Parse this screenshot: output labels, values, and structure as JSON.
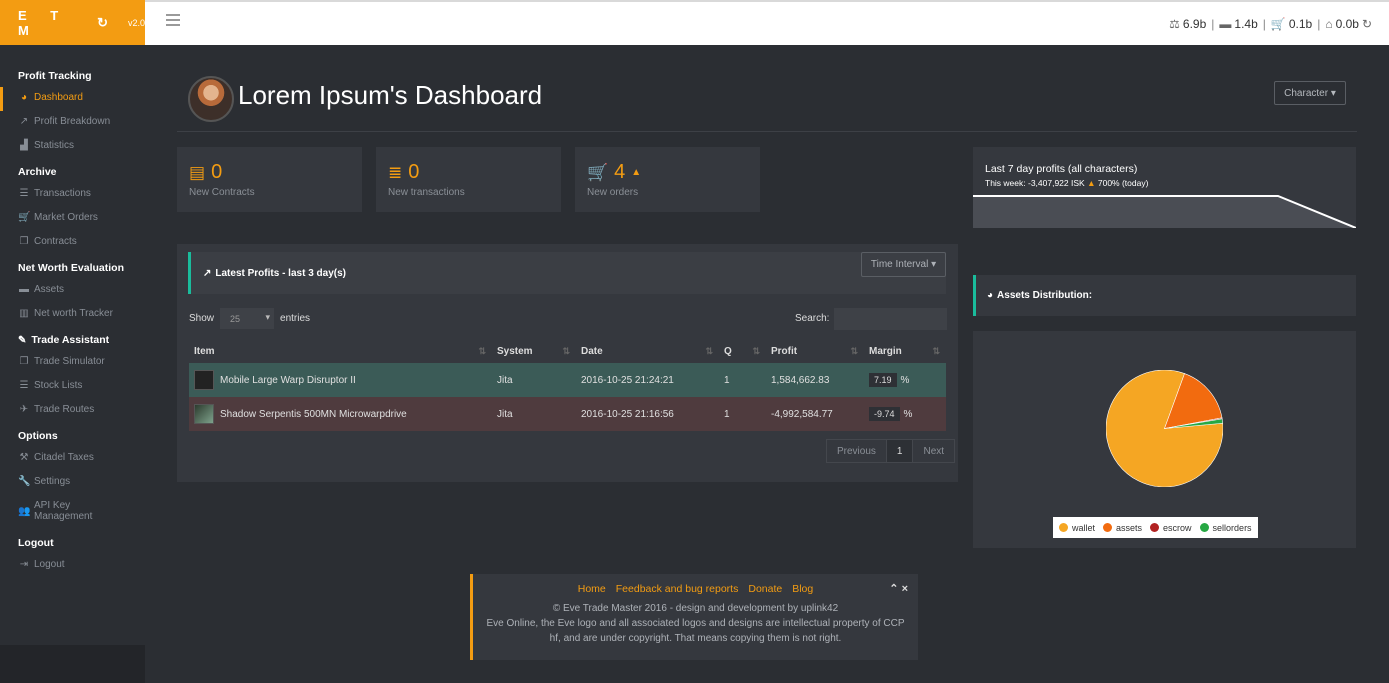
{
  "brand": {
    "logo": "E T M",
    "refresh_icon": "↻",
    "version": "v2.0"
  },
  "topbar": {
    "wealth": [
      {
        "icon": "scale-icon",
        "glyph": "⚖",
        "value": "6.9b"
      },
      {
        "icon": "briefcase-icon",
        "glyph": "▬",
        "value": "1.4b"
      },
      {
        "icon": "cart-icon",
        "glyph": "🛒",
        "value": "0.1b"
      },
      {
        "icon": "bank-icon",
        "glyph": "⌂",
        "value": "0.0b"
      }
    ],
    "separator": "|",
    "refresh_icon": "↻"
  },
  "sidebar": {
    "sections": [
      {
        "title": "Profit Tracking",
        "items": [
          {
            "label": "Dashboard",
            "icon": "dashboard-icon",
            "glyph": "◕",
            "active": true
          },
          {
            "label": "Profit Breakdown",
            "icon": "line-chart-icon",
            "glyph": "↗"
          },
          {
            "label": "Statistics",
            "icon": "area-chart-icon",
            "glyph": "▟"
          }
        ]
      },
      {
        "title": "Archive",
        "items": [
          {
            "label": "Transactions",
            "icon": "list-icon",
            "glyph": "☰"
          },
          {
            "label": "Market Orders",
            "icon": "cart-icon",
            "glyph": "🛒"
          },
          {
            "label": "Contracts",
            "icon": "copy-icon",
            "glyph": "❐"
          }
        ]
      },
      {
        "title": "Net Worth Evaluation",
        "items": [
          {
            "label": "Assets",
            "icon": "briefcase-icon",
            "glyph": "▬"
          },
          {
            "label": "Net worth Tracker",
            "icon": "bar-chart-icon",
            "glyph": "▥"
          }
        ]
      },
      {
        "title": "Trade Assistant",
        "title_icon": "magic-icon",
        "title_glyph": "✎",
        "items": [
          {
            "label": "Trade Simulator",
            "icon": "copy-icon",
            "glyph": "❐"
          },
          {
            "label": "Stock Lists",
            "icon": "list-icon",
            "glyph": "☰"
          },
          {
            "label": "Trade Routes",
            "icon": "plane-icon",
            "glyph": "✈"
          }
        ]
      },
      {
        "title": "Options",
        "items": [
          {
            "label": "Citadel Taxes",
            "icon": "gavel-icon",
            "glyph": "⚒"
          },
          {
            "label": "Settings",
            "icon": "wrench-icon",
            "glyph": "🔧"
          },
          {
            "label": "API Key Management",
            "icon": "users-icon",
            "glyph": "👥"
          }
        ]
      },
      {
        "title": "Logout",
        "items": [
          {
            "label": "Logout",
            "icon": "sign-out-icon",
            "glyph": "⇥"
          }
        ]
      }
    ]
  },
  "header": {
    "title": "Lorem Ipsum's Dashboard",
    "character_button": "Character ▾"
  },
  "stats": [
    {
      "value": "0",
      "label": "New Contracts",
      "icon": "contract-icon",
      "glyph": "▤"
    },
    {
      "value": "0",
      "label": "New transactions",
      "icon": "stack-icon",
      "glyph": "≣"
    },
    {
      "value": "4",
      "label": "New orders",
      "icon": "cart-icon",
      "glyph": "🛒",
      "trend": "▲"
    }
  ],
  "profits_panel": {
    "title": "Latest Profits - last 3 day(s)",
    "title_icon": "line-chart-icon",
    "time_button": "Time Interval ▾",
    "show_label": "Show",
    "entries_value": "25",
    "entries_label": "entries",
    "search_label": "Search:",
    "columns": [
      "Item",
      "System",
      "Date",
      "Q",
      "Profit",
      "Margin"
    ],
    "rows": [
      {
        "item": "Mobile Large Warp Disruptor II",
        "system": "Jita",
        "date": "2016-10-25 21:24:21",
        "q": "1",
        "profit": "1,584,662.83",
        "margin": "7.19",
        "unit": "%",
        "status": "positive"
      },
      {
        "item": "Shadow Serpentis 500MN Microwarpdrive",
        "system": "Jita",
        "date": "2016-10-25 21:16:56",
        "q": "1",
        "profit": "-4,992,584.77",
        "margin": "-9.74",
        "unit": "%",
        "status": "negative"
      }
    ],
    "pager": {
      "previous": "Previous",
      "current": "1",
      "next": "Next"
    }
  },
  "weekly_profit": {
    "title": "Last 7 day profits (all characters)",
    "sub_prefix": "This week: -3,407,922 ISK",
    "trend": "▲",
    "sub_suffix": "700% (today)"
  },
  "assets": {
    "title": "Assets Distribution:",
    "title_icon": "pie-chart-icon",
    "legend": [
      {
        "label": "wallet",
        "color": "#f5a623"
      },
      {
        "label": "assets",
        "color": "#f26b0f"
      },
      {
        "label": "escrow",
        "color": "#b22222"
      },
      {
        "label": "sellorders",
        "color": "#27a844"
      }
    ],
    "distribution": {
      "wallet": 0.82,
      "assets": 0.165,
      "escrow": 0.003,
      "sellorders": 0.012
    }
  },
  "footer": {
    "links": [
      "Home",
      "Feedback and bug reports",
      "Donate",
      "Blog"
    ],
    "controls": "⌃ ×",
    "copyright": "© Eve Trade Master 2016 - design and development by uplink42",
    "legal": "Eve Online, the Eve logo and all associated logos and designs are intellectual property of CCP hf, and are under copyright. That means copying them is not right."
  },
  "colors": {
    "accent": "#f39c12",
    "teal": "#1abc9c",
    "panel": "#35383e",
    "background": "#2b2e33"
  }
}
